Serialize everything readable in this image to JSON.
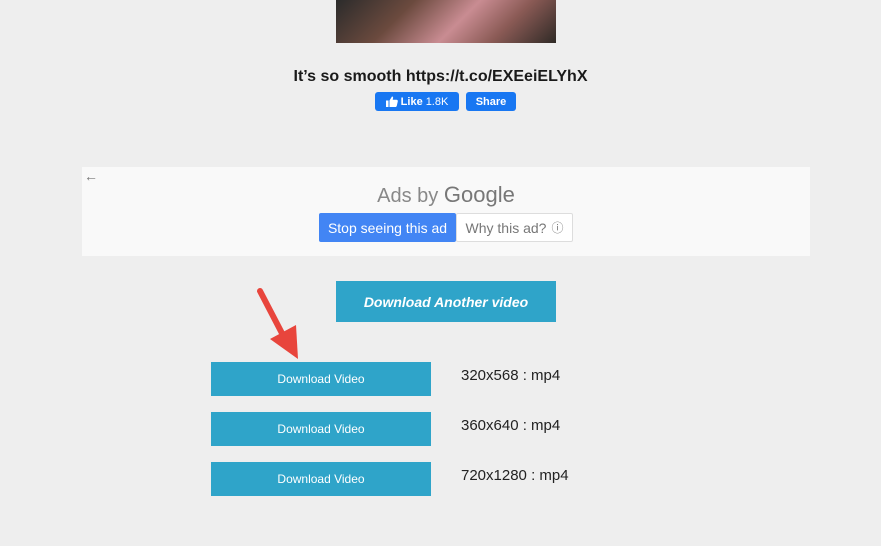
{
  "tweet": {
    "text": "It’s so smooth https://t.co/EXEeiELYhX"
  },
  "facebook": {
    "like_label": "Like",
    "like_count": "1.8K",
    "share_label": "Share"
  },
  "ad": {
    "ads_by": "Ads by",
    "google": "Google",
    "stop_label": "Stop seeing this ad",
    "why_label": "Why this ad?",
    "back_icon": "←",
    "info_icon": "ⓘ"
  },
  "download_another_label": "Download Another video",
  "downloads": [
    {
      "button_label": "Download Video",
      "format": "320x568 : mp4"
    },
    {
      "button_label": "Download Video",
      "format": "360x640 : mp4"
    },
    {
      "button_label": "Download Video",
      "format": "720x1280 : mp4"
    }
  ],
  "colors": {
    "accent_button": "#2fa4c9",
    "facebook_blue": "#1877f2",
    "google_blue": "#4285f4",
    "annotation_arrow": "#e8453c"
  }
}
